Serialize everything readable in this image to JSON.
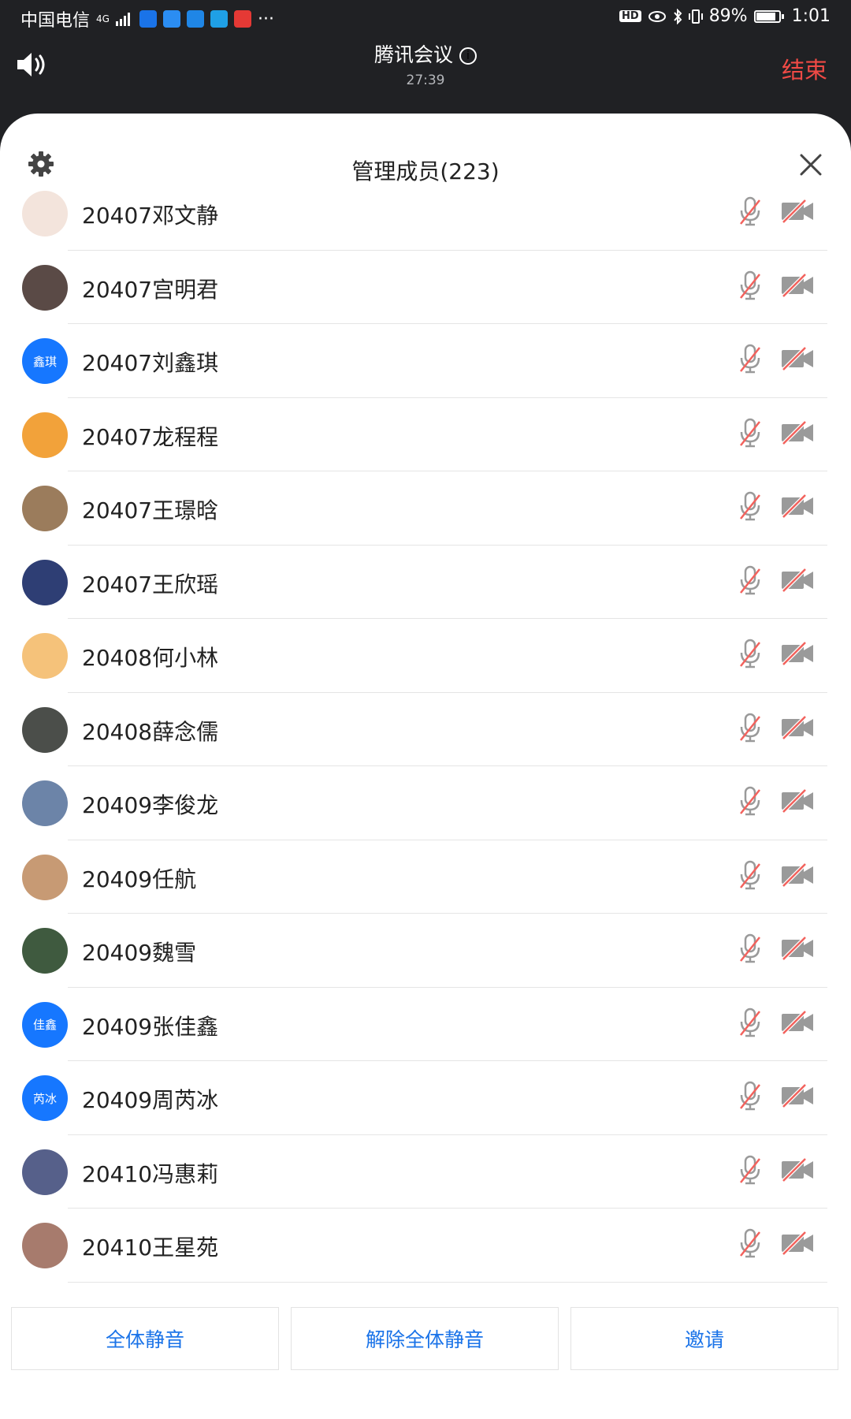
{
  "status_bar": {
    "carrier": "中国电信",
    "network": "4G",
    "battery": "89%",
    "time": "1:01",
    "hd_badge": "HD",
    "more": "···"
  },
  "meeting": {
    "title": "腾讯会议",
    "info_symbol": "i",
    "duration": "27:39",
    "end_label": "结束"
  },
  "panel": {
    "title": "管理成员(223)"
  },
  "colors": {
    "accent": "#1a73e8",
    "end_red": "#f04a45",
    "muted_red": "#f2625d",
    "avatar_blue": "#1677ff"
  },
  "members": [
    {
      "name": "20407邓文静",
      "avatar_text": "",
      "avatar_color": "#f3e4dc"
    },
    {
      "name": "20407宫明君",
      "avatar_text": "",
      "avatar_color": "#5a4a46"
    },
    {
      "name": "20407刘鑫琪",
      "avatar_text": "鑫琪",
      "avatar_color": "#1677ff"
    },
    {
      "name": "20407龙程程",
      "avatar_text": "",
      "avatar_color": "#f2a23a"
    },
    {
      "name": "20407王璟晗",
      "avatar_text": "",
      "avatar_color": "#9b7c5c"
    },
    {
      "name": "20407王欣瑶",
      "avatar_text": "",
      "avatar_color": "#2e3e74"
    },
    {
      "name": "20408何小林",
      "avatar_text": "",
      "avatar_color": "#f5c27a"
    },
    {
      "name": "20408薛念儒",
      "avatar_text": "",
      "avatar_color": "#4b4e4a"
    },
    {
      "name": "20409李俊龙",
      "avatar_text": "",
      "avatar_color": "#6c84a8"
    },
    {
      "name": "20409任航",
      "avatar_text": "",
      "avatar_color": "#c79a74"
    },
    {
      "name": "20409魏雪",
      "avatar_text": "",
      "avatar_color": "#3f5a3f"
    },
    {
      "name": "20409张佳鑫",
      "avatar_text": "佳鑫",
      "avatar_color": "#1677ff"
    },
    {
      "name": "20409周芮冰",
      "avatar_text": "芮冰",
      "avatar_color": "#1677ff"
    },
    {
      "name": "20410冯惠莉",
      "avatar_text": "",
      "avatar_color": "#56608a"
    },
    {
      "name": "20410王星苑",
      "avatar_text": "",
      "avatar_color": "#a77b6d"
    }
  ],
  "bottom_buttons": {
    "mute_all": "全体静音",
    "unmute_all": "解除全体静音",
    "invite": "邀请"
  }
}
